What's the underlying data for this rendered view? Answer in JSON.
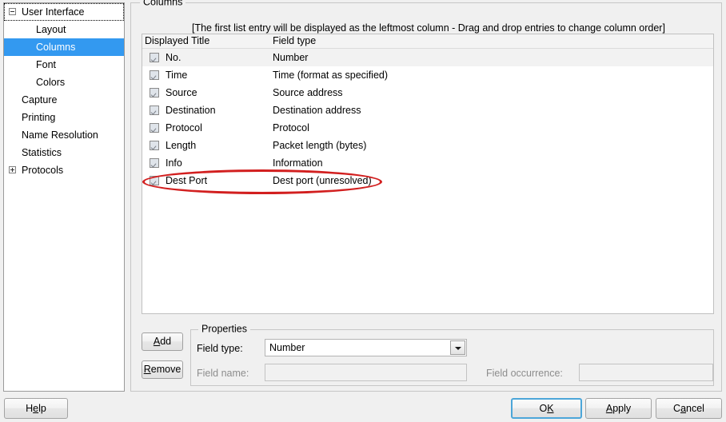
{
  "sidebar": {
    "items": [
      {
        "label": "User Interface",
        "level": 0,
        "toggle": "minus",
        "selected": false,
        "focused": true
      },
      {
        "label": "Layout",
        "level": 2,
        "toggle": "none",
        "selected": false,
        "focused": false
      },
      {
        "label": "Columns",
        "level": 2,
        "toggle": "none",
        "selected": true,
        "focused": false
      },
      {
        "label": "Font",
        "level": 2,
        "toggle": "none",
        "selected": false,
        "focused": false
      },
      {
        "label": "Colors",
        "level": 2,
        "toggle": "none",
        "selected": false,
        "focused": false
      },
      {
        "label": "Capture",
        "level": 1,
        "toggle": "none",
        "selected": false,
        "focused": false
      },
      {
        "label": "Printing",
        "level": 1,
        "toggle": "none",
        "selected": false,
        "focused": false
      },
      {
        "label": "Name Resolution",
        "level": 1,
        "toggle": "none",
        "selected": false,
        "focused": false
      },
      {
        "label": "Statistics",
        "level": 1,
        "toggle": "none",
        "selected": false,
        "focused": false
      },
      {
        "label": "Protocols",
        "level": 0,
        "toggle": "plus",
        "selected": false,
        "focused": false
      }
    ]
  },
  "columns_group": {
    "label": "Columns",
    "hint": "[The first list entry will be displayed as the leftmost column - Drag and drop entries to change column order]",
    "table": {
      "headers": [
        "Displayed Title",
        "Field type"
      ],
      "rows": [
        {
          "checked": true,
          "title": "No.",
          "type": "Number",
          "highlighted": true,
          "annotated": false
        },
        {
          "checked": true,
          "title": "Time",
          "type": "Time (format as specified)",
          "highlighted": false,
          "annotated": false
        },
        {
          "checked": true,
          "title": "Source",
          "type": "Source address",
          "highlighted": false,
          "annotated": false
        },
        {
          "checked": true,
          "title": "Destination",
          "type": "Destination address",
          "highlighted": false,
          "annotated": false
        },
        {
          "checked": true,
          "title": "Protocol",
          "type": "Protocol",
          "highlighted": false,
          "annotated": false
        },
        {
          "checked": true,
          "title": "Length",
          "type": "Packet length (bytes)",
          "highlighted": false,
          "annotated": false
        },
        {
          "checked": true,
          "title": "Info",
          "type": "Information",
          "highlighted": false,
          "annotated": false
        },
        {
          "checked": true,
          "title": "Dest Port",
          "type": "Dest port (unresolved)",
          "highlighted": false,
          "annotated": true
        }
      ]
    },
    "add_label": "Add",
    "remove_label": "Remove"
  },
  "properties": {
    "label": "Properties",
    "field_type_label": "Field type:",
    "field_type_value": "Number",
    "field_name_label": "Field name:",
    "field_name_value": "",
    "field_occurrence_label": "Field occurrence:",
    "field_occurrence_value": ""
  },
  "footer": {
    "help_label": "Help",
    "ok_label": "OK",
    "apply_label": "Apply",
    "cancel_label": "Cancel"
  },
  "colors": {
    "selection_blue": "#3399f0",
    "annotation_red": "#d21f1f",
    "focus_border_blue": "#4ca6d9",
    "dialog_bg": "#f0f0f0"
  }
}
